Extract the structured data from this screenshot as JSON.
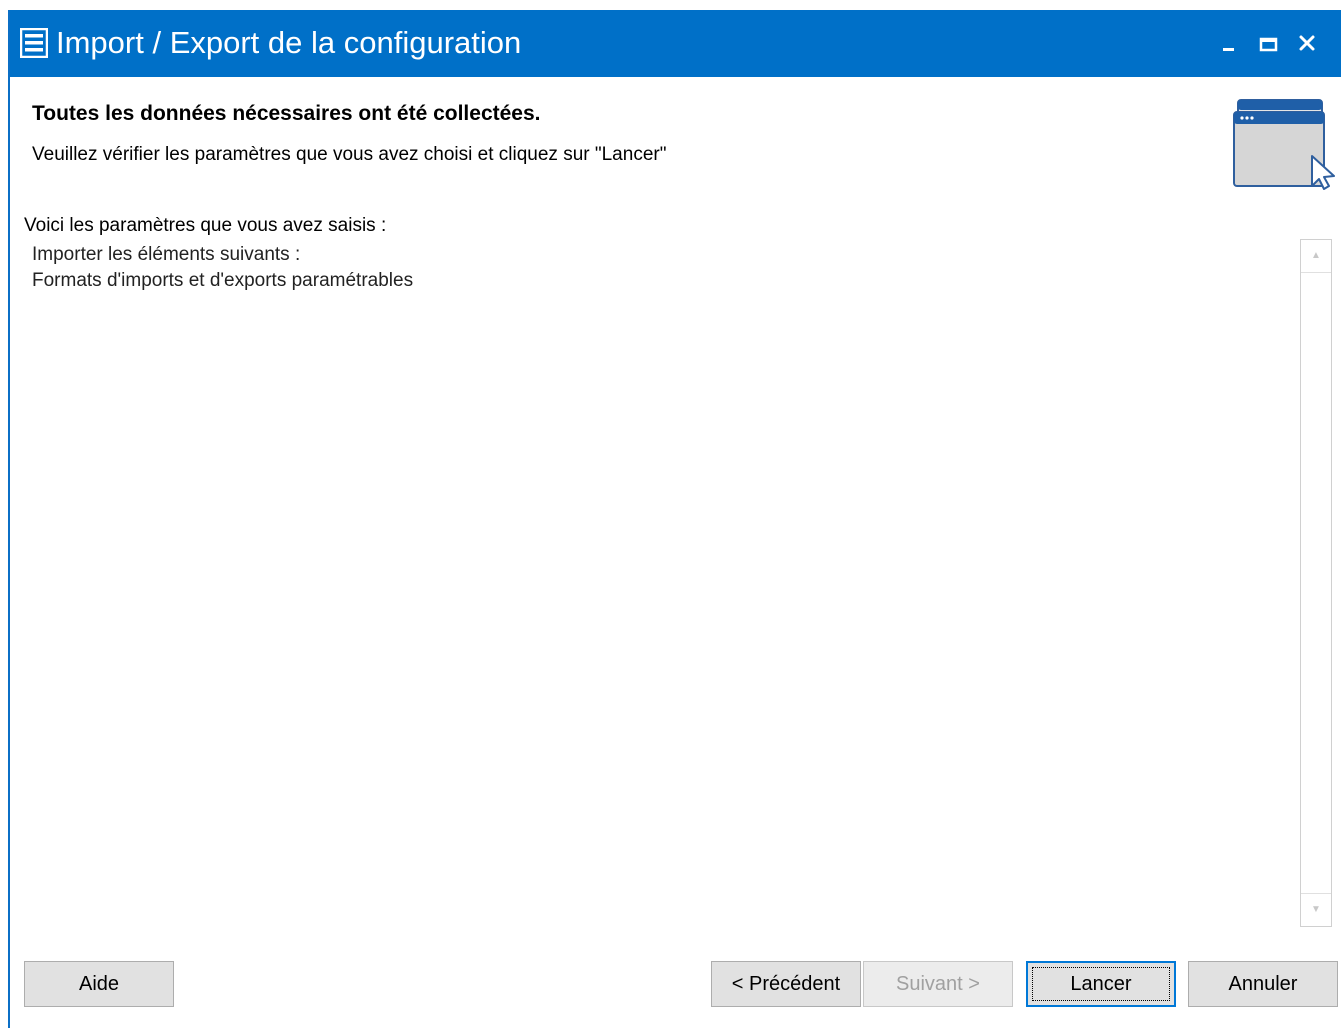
{
  "window": {
    "title": "Import / Export de la configuration",
    "accent_color": "#0070c8",
    "icon": "app-list-icon",
    "controls": [
      "minimize-icon",
      "maximize-icon",
      "close-icon"
    ]
  },
  "header": {
    "title": "Toutes les données nécessaires ont été collectées.",
    "subtitle": "Veuillez vérifier les paramètres que vous avez choisi et cliquez sur \"Lancer\"",
    "icon": "wizard-window-cursor-icon"
  },
  "content": {
    "heading": "Voici les paramètres que vous avez saisis :",
    "lines": [
      "Importer les éléments suivants :",
      "Formats d'imports et d'exports paramétrables"
    ]
  },
  "buttons": {
    "help": "Aide",
    "previous": "< Précédent",
    "next": "Suivant >",
    "launch": "Lancer",
    "cancel": "Annuler"
  }
}
